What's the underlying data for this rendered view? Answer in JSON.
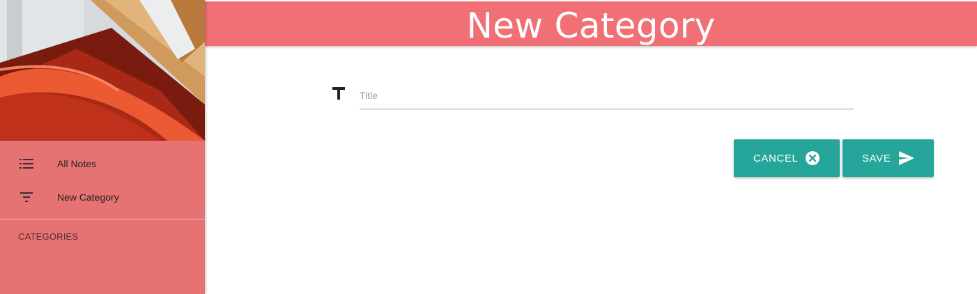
{
  "header": {
    "title": "New Category"
  },
  "sidebar": {
    "items": [
      {
        "label": "All Notes",
        "icon": "list-icon"
      },
      {
        "label": "New Category",
        "icon": "filter-icon"
      }
    ],
    "categories_header": "CATEGORIES"
  },
  "form": {
    "title_placeholder": "Title",
    "title_value": "",
    "title_icon": "text-title-icon"
  },
  "actions": {
    "cancel_label": "CANCEL",
    "cancel_icon": "cancel-circle-icon",
    "save_label": "SAVE",
    "save_icon": "send-icon"
  },
  "colors": {
    "sidebar": "#e57373",
    "header": "#f07076",
    "button": "#26a69a"
  }
}
